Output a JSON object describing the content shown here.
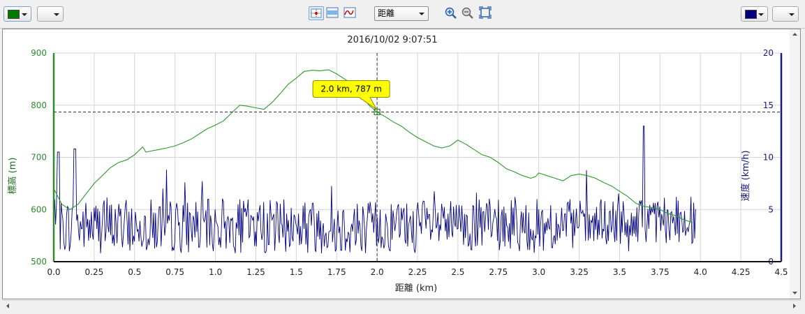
{
  "toolbar": {
    "left_color": "#007a00",
    "right_color": "#000080",
    "xaxis_select": "距離",
    "icons": [
      "crosshair-icon",
      "band-icon",
      "wave-icon",
      "zoom-in-icon",
      "zoom-out-icon",
      "fit-icon"
    ]
  },
  "chart_data": {
    "type": "line",
    "title": "2016/10/02 9:07:51",
    "xlabel": "距離 (km)",
    "ylabel_left": "標高 (m)",
    "ylabel_right": "速度 (km/h)",
    "xlim": [
      0,
      4.5
    ],
    "ylim_left": [
      500,
      900
    ],
    "ylim_right": [
      0,
      20
    ],
    "x_ticks": [
      "0.0",
      "0.25",
      "0.5",
      "0.75",
      "1.0",
      "1.25",
      "1.5",
      "1.75",
      "2.0",
      "2.25",
      "2.5",
      "2.75",
      "3.0",
      "3.25",
      "3.5",
      "3.75",
      "4.0",
      "4.25",
      "4.5"
    ],
    "y_left_ticks": [
      "900",
      "800",
      "700",
      "600",
      "500"
    ],
    "y_right_ticks": [
      "20",
      "15",
      "10",
      "5",
      "0"
    ],
    "grid": true,
    "left_axis_color": "#2e8b2e",
    "right_axis_color": "#1a1a7a",
    "cursor": {
      "x": 2.0,
      "y": 787,
      "label": "2.0 km, 787 m"
    },
    "series": [
      {
        "name": "標高",
        "axis": "left",
        "color": "#2a9a2a",
        "x": [
          0,
          0.05,
          0.1,
          0.15,
          0.2,
          0.25,
          0.3,
          0.35,
          0.4,
          0.45,
          0.5,
          0.55,
          0.57,
          0.6,
          0.65,
          0.7,
          0.75,
          0.8,
          0.85,
          0.9,
          0.95,
          1.0,
          1.05,
          1.1,
          1.15,
          1.2,
          1.25,
          1.3,
          1.35,
          1.4,
          1.45,
          1.5,
          1.55,
          1.6,
          1.65,
          1.7,
          1.75,
          1.8,
          1.85,
          1.9,
          1.95,
          2.0,
          2.05,
          2.1,
          2.15,
          2.2,
          2.25,
          2.3,
          2.35,
          2.4,
          2.45,
          2.5,
          2.55,
          2.6,
          2.65,
          2.7,
          2.75,
          2.8,
          2.85,
          2.9,
          2.95,
          2.98,
          3.0,
          3.05,
          3.1,
          3.15,
          3.2,
          3.25,
          3.3,
          3.35,
          3.4,
          3.45,
          3.5,
          3.55,
          3.6,
          3.65,
          3.7,
          3.75,
          3.8,
          3.85,
          3.9,
          3.95
        ],
        "y": [
          640,
          610,
          600,
          610,
          630,
          650,
          665,
          680,
          690,
          695,
          705,
          720,
          710,
          712,
          715,
          718,
          722,
          728,
          735,
          745,
          755,
          762,
          770,
          785,
          800,
          798,
          795,
          792,
          805,
          822,
          840,
          852,
          865,
          867,
          866,
          868,
          860,
          850,
          840,
          820,
          800,
          787,
          778,
          768,
          760,
          748,
          738,
          730,
          722,
          718,
          722,
          733,
          725,
          715,
          705,
          700,
          690,
          678,
          672,
          665,
          660,
          663,
          670,
          665,
          660,
          655,
          665,
          668,
          665,
          660,
          652,
          645,
          635,
          625,
          612,
          606,
          604,
          600,
          592,
          588,
          580,
          575
        ]
      }
    ]
  },
  "speed_profile_color": "#000080"
}
